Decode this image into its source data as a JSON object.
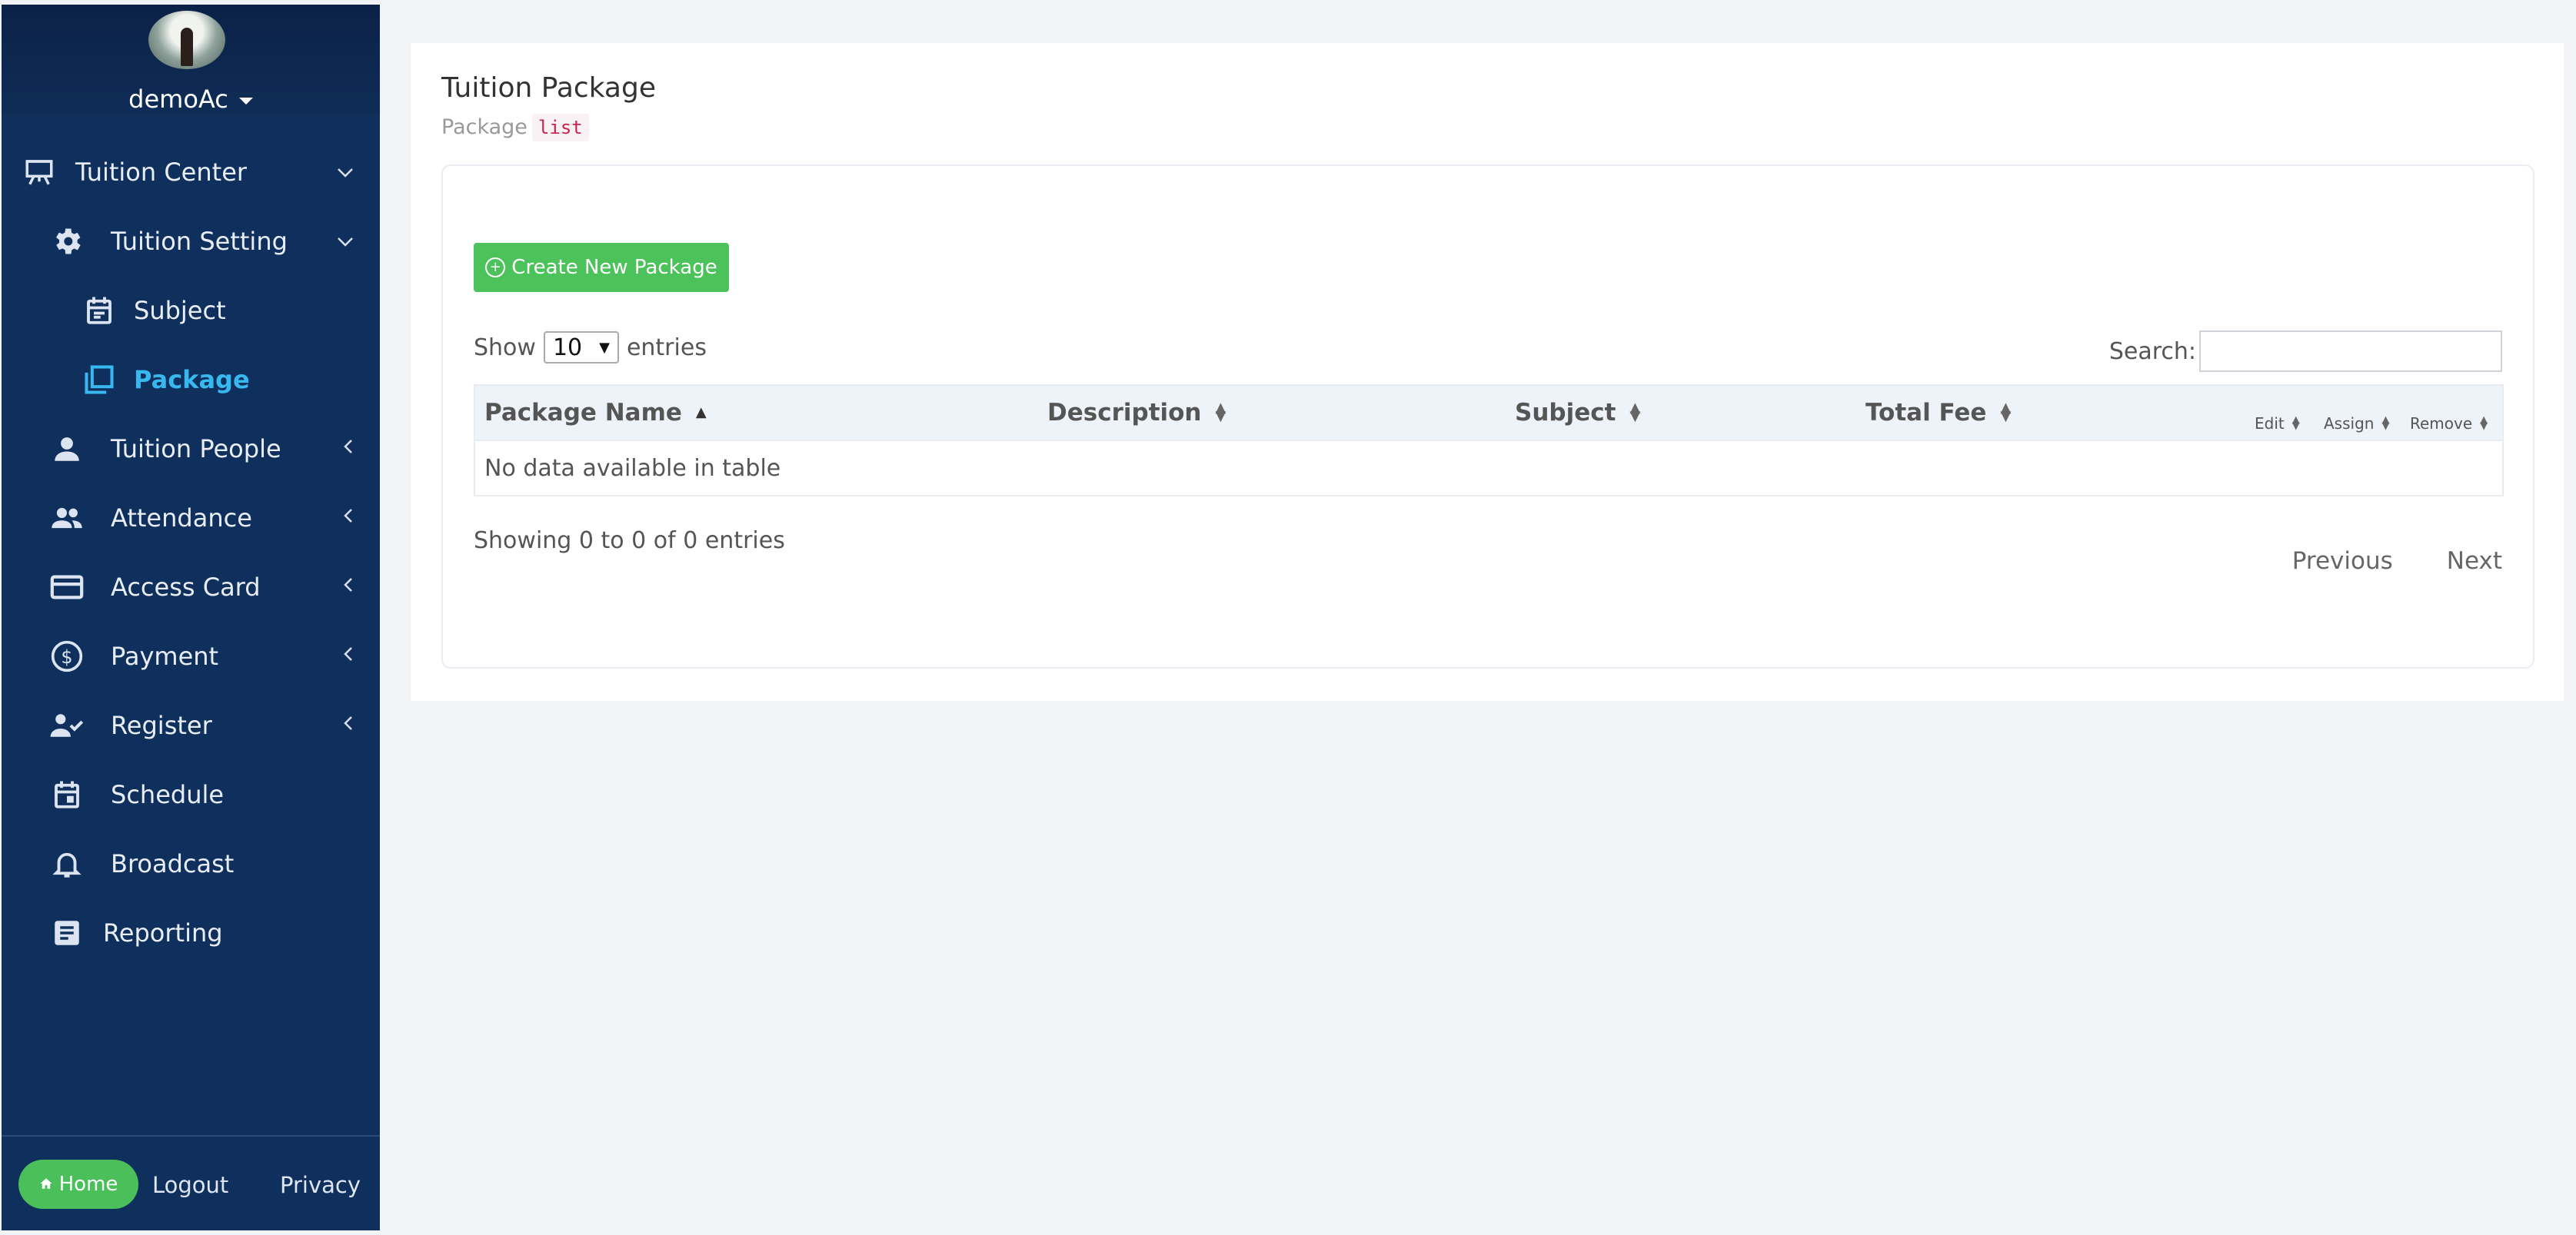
{
  "sidebar": {
    "user": "demoAc",
    "items": [
      {
        "label": "Tuition Center",
        "icon": "presentation-board-icon",
        "chevron": "⌄"
      },
      {
        "label": "Tuition Setting",
        "icon": "gear-icon",
        "chevron": "⌄"
      },
      {
        "label": "Subject",
        "icon": "calendar-list-icon",
        "chevron": ""
      },
      {
        "label": "Package",
        "icon": "stacked-squares-icon",
        "chevron": ""
      },
      {
        "label": "Tuition People",
        "icon": "person-icon",
        "chevron": "‹"
      },
      {
        "label": "Attendance",
        "icon": "group-icon",
        "chevron": "‹"
      },
      {
        "label": "Access Card",
        "icon": "credit-card-icon",
        "chevron": "‹"
      },
      {
        "label": "Payment",
        "icon": "dollar-circle-icon",
        "chevron": "‹"
      },
      {
        "label": "Register",
        "icon": "person-check-icon",
        "chevron": "‹"
      },
      {
        "label": "Schedule",
        "icon": "calendar-icon",
        "chevron": ""
      },
      {
        "label": "Broadcast",
        "icon": "bell-icon",
        "chevron": ""
      },
      {
        "label": "Reporting",
        "icon": "document-icon",
        "chevron": ""
      }
    ],
    "footer": {
      "home": "Home",
      "logout": "Logout",
      "privacy": "Privacy"
    }
  },
  "main": {
    "title": "Tuition Package",
    "crumb_text": "Package",
    "crumb_code": "list",
    "create_button": "Create New Package",
    "show_label": "Show",
    "entries_label": "entries",
    "page_length": "10",
    "search_label": "Search:",
    "columns": [
      "Package Name",
      "Description",
      "Subject",
      "Total Fee",
      "Edit",
      "Assign",
      "Remove"
    ],
    "empty_text": "No data available in table",
    "info_text": "Showing 0 to 0 of 0 entries",
    "prev": "Previous",
    "next": "Next"
  },
  "colors": {
    "sidebar_bg": "#0f305d",
    "active_item": "#37b9f0",
    "green": "#4cc25a"
  }
}
